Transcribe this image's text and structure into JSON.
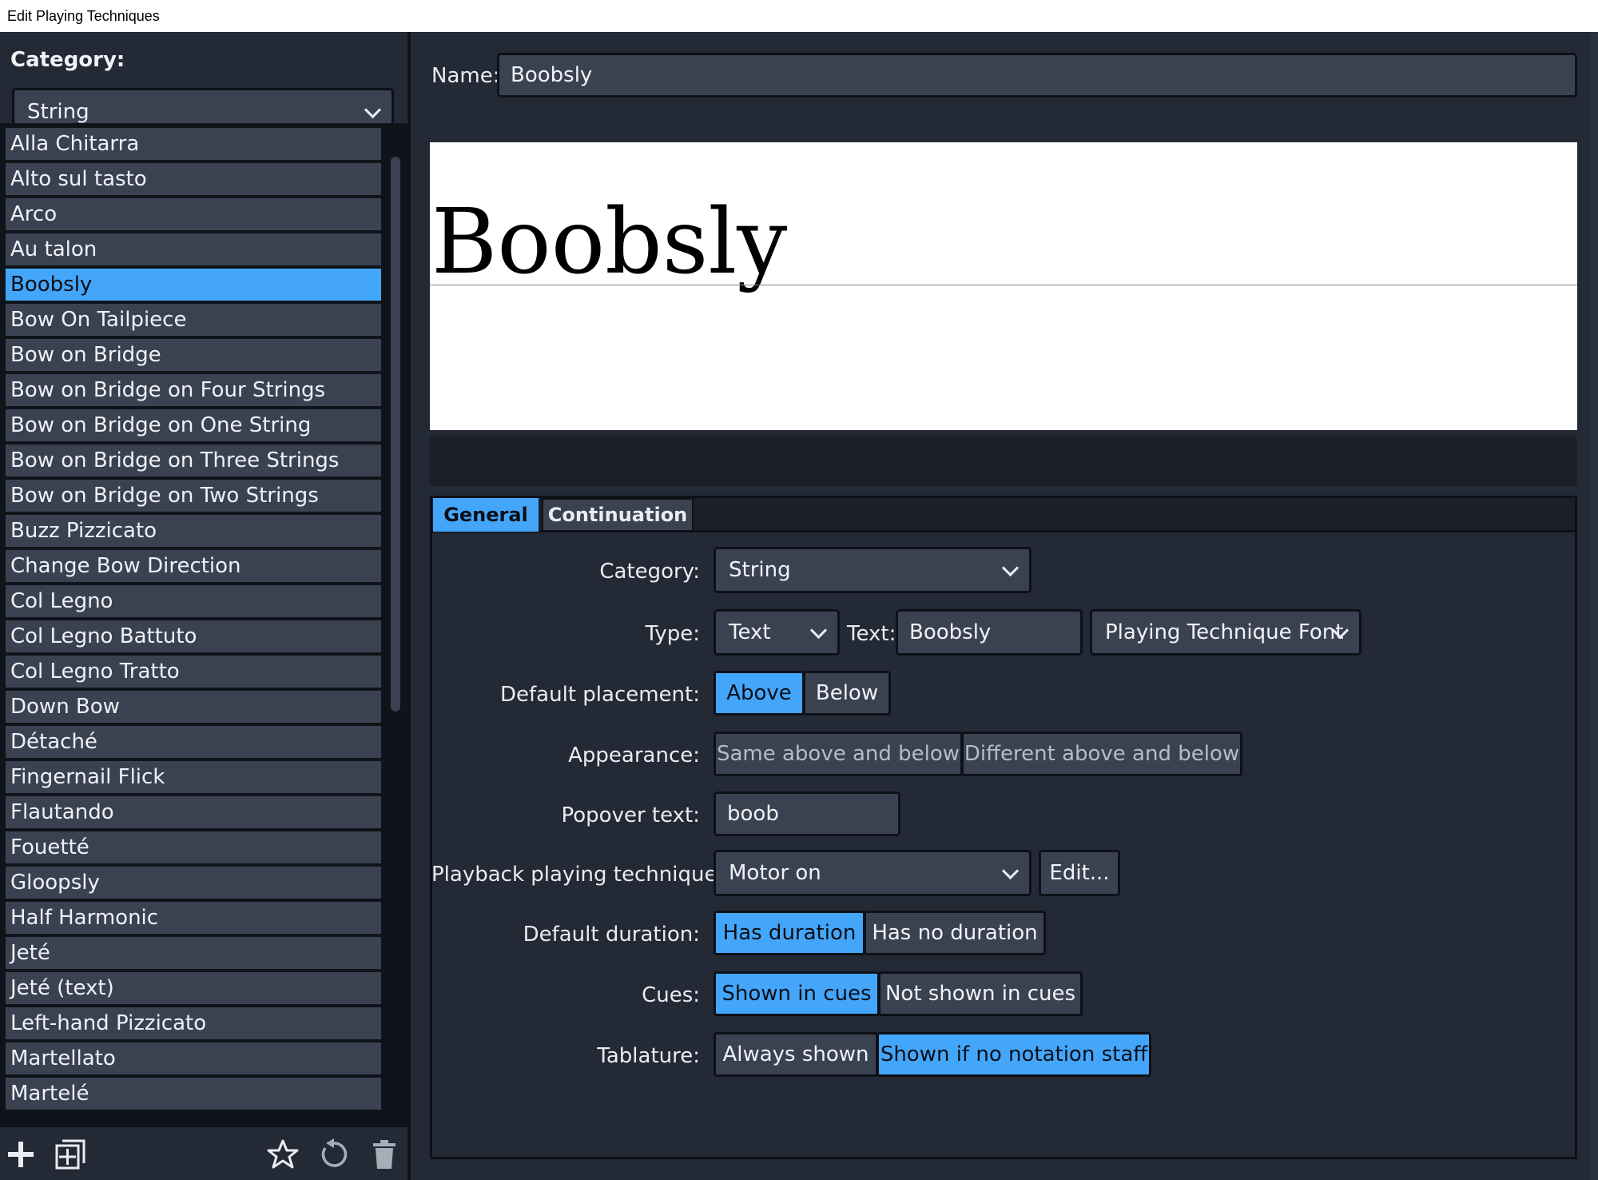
{
  "window": {
    "title": "Edit Playing Techniques"
  },
  "sidebar": {
    "category_label": "Category:",
    "category_value": "String",
    "items": [
      "Alla Chitarra",
      "Alto sul tasto",
      "Arco",
      "Au talon",
      "Boobsly",
      "Bow On Tailpiece",
      "Bow on Bridge",
      "Bow on Bridge on Four Strings",
      "Bow on Bridge on One String",
      "Bow on Bridge on Three Strings",
      "Bow on Bridge on Two Strings",
      "Buzz Pizzicato",
      "Change Bow Direction",
      "Col Legno",
      "Col Legno Battuto",
      "Col Legno Tratto",
      "Down Bow",
      "Détaché",
      "Fingernail Flick",
      "Flautando",
      "Fouetté",
      "Gloopsly",
      "Half Harmonic",
      "Jeté",
      "Jeté (text)",
      "Left-hand Pizzicato",
      "Martellato",
      "Martelé"
    ],
    "selected_item": "Boobsly",
    "toolbar_icons": [
      "plus-icon",
      "duplicate-icon",
      "star-icon",
      "reset-icon",
      "trash-icon"
    ]
  },
  "editor": {
    "name_label": "Name:",
    "name_value": "Boobsly",
    "preview_text": "Boobsly",
    "tabs": {
      "general": "General",
      "continuation": "Continuation",
      "active": "General"
    },
    "general": {
      "category_label": "Category:",
      "category_value": "String",
      "type_label": "Type:",
      "type_value": "Text",
      "text_label": "Text:",
      "text_value": "Boobsly",
      "font_value": "Playing Technique Font",
      "placement_label": "Default placement:",
      "placement_above": "Above",
      "placement_below": "Below",
      "placement_selected": "Above",
      "appearance_label": "Appearance:",
      "appearance_same": "Same above and below",
      "appearance_different": "Different above and below",
      "popover_label": "Popover text:",
      "popover_value": "boob",
      "playback_label": "Playback playing technique:",
      "playback_value": "Motor on",
      "playback_edit": "Edit...",
      "duration_label": "Default duration:",
      "duration_has": "Has duration",
      "duration_none": "Has no duration",
      "duration_selected": "Has duration",
      "cues_label": "Cues:",
      "cues_shown": "Shown in cues",
      "cues_not_shown": "Not shown in cues",
      "cues_selected": "Shown in cues",
      "tablature_label": "Tablature:",
      "tablature_always": "Always shown",
      "tablature_no_staff": "Shown if no notation staff",
      "tablature_selected": "Shown if no notation staff"
    }
  },
  "colors": {
    "accent": "#44a6fa",
    "panel": "#232a36",
    "control": "#3a4252",
    "border": "#0d1117"
  }
}
